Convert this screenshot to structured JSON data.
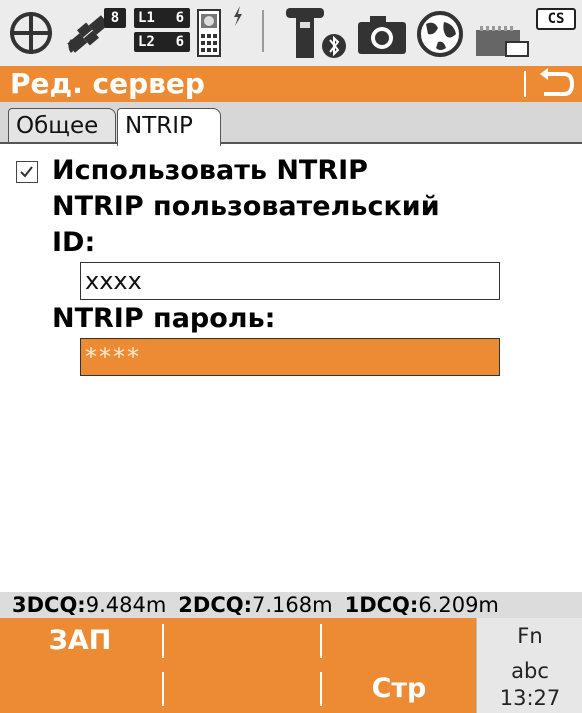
{
  "status_bar": {
    "sat_count": "8",
    "band_l1": {
      "label": "L1",
      "count": "6"
    },
    "band_l2": {
      "label": "L2",
      "count": "6"
    },
    "cs_badge": "CS",
    "icons": [
      "position-crosshair-icon",
      "satellite-icon",
      "data-logging-icon",
      "lightning-icon",
      "antenna-bluetooth-icon",
      "camera-icon",
      "globe-icon",
      "sd-card-icon"
    ]
  },
  "title_bar": {
    "title": "Ред. сервер",
    "back_icon": "back-arrow-icon"
  },
  "tabs": [
    {
      "label": "Общее",
      "active": false
    },
    {
      "label": "NTRIP",
      "active": true
    }
  ],
  "form": {
    "use_ntrip": {
      "label": "Использовать  NTRIP",
      "checked": true
    },
    "user_id_label_line1": "NTRIP пользовательский",
    "user_id_label_line2": "ID:",
    "user_id_value": "xxxx",
    "password_label": "NTRIP пароль:",
    "password_value": "****"
  },
  "quality_bar": {
    "items": [
      {
        "key": "3DCQ:",
        "value": "9.484m"
      },
      {
        "key": "2DCQ:",
        "value": "7.168m"
      },
      {
        "key": "1DCQ:",
        "value": "6.209m"
      }
    ]
  },
  "softkeys": {
    "f1": "ЗАП",
    "f2": "",
    "f3": "",
    "f4": "",
    "f5": "",
    "f6": "Стр"
  },
  "fn_panel": {
    "fn": "Fn",
    "mode": "abc",
    "time": "13:27"
  },
  "colors": {
    "accent": "#ed8b35",
    "status_bg": "#ececec",
    "tab_bg": "#d7d7d7"
  }
}
